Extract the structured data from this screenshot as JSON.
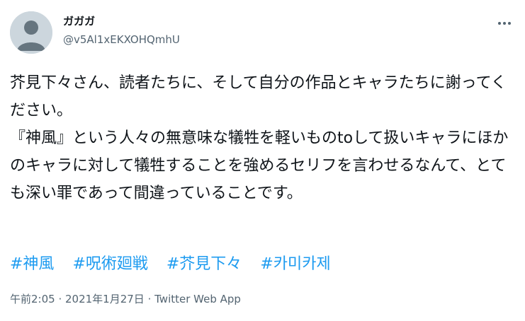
{
  "user": {
    "display_name": "ガガガ",
    "handle": "@v5Al1xEKXOHQmhU",
    "avatar_icon": "default-avatar-icon"
  },
  "more_icon": "ellipsis-icon",
  "tweet": {
    "text": "芥見下々さん、読者たちに、そして自分の作品とキャラたちに謝ってください。\n『神風』という人々の無意味な犠牲を軽いものtoして扱いキャラにほかのキャラに対して犠牲することを強めるセリフを言わせるなんて、とても深い罪であって間違っていることです。",
    "hashtags": [
      "#神風",
      "#呪術廻戦",
      "#芥見下々",
      "#카미카제"
    ]
  },
  "meta": {
    "time": "午前2:05",
    "separator": " · ",
    "date": "2021年1月27日",
    "source": "Twitter Web App"
  },
  "colors": {
    "link": "#1d9bf0",
    "secondary_text": "#536471",
    "primary_text": "#0f1419",
    "avatar_bg": "#ccd6dd"
  }
}
